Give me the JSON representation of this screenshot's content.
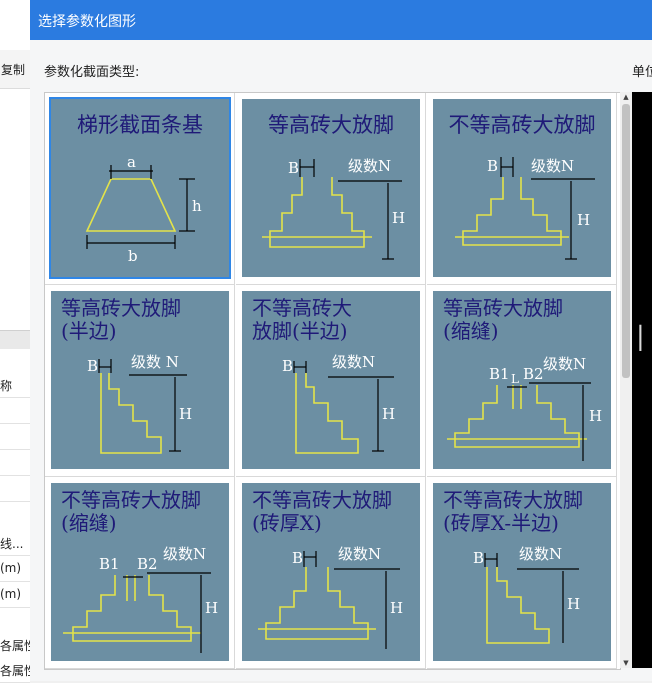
{
  "background": {
    "toolbar_text": "复制",
    "column_header": "称",
    "rows": [
      "线...",
      "(m)",
      "(m)",
      "各属性",
      "各属性"
    ]
  },
  "dialog": {
    "title": "选择参数化图形",
    "section_label": "参数化截面类型:",
    "unit_label": "单位",
    "preview_char": "|"
  },
  "tiles": [
    {
      "title": "梯形截面条基",
      "labels": {
        "a": "a",
        "b": "b",
        "h": "h"
      }
    },
    {
      "title": "等高砖大放脚",
      "labels": {
        "B": "B",
        "N": "级数N",
        "H": "H"
      }
    },
    {
      "title": "不等高砖大放脚",
      "labels": {
        "B": "B",
        "N": "级数N",
        "H": "H"
      }
    },
    {
      "title": "等高砖大放脚\n(半边)",
      "labels": {
        "B": "B",
        "N": "级数 N",
        "H": "H"
      }
    },
    {
      "title": "不等高砖大\n放脚(半边)",
      "labels": {
        "B": "B",
        "N": "级数N",
        "H": "H"
      }
    },
    {
      "title": "等高砖大放脚\n(缩缝)",
      "labels": {
        "B1": "B1",
        "B2": "B2",
        "N": "级数N",
        "L": "L",
        "H": "H"
      }
    },
    {
      "title": "不等高砖大放脚\n(缩缝)",
      "labels": {
        "B1": "B1",
        "B2": "B2",
        "N": "级数N",
        "H": "H"
      }
    },
    {
      "title": "不等高砖大放脚\n(砖厚X)",
      "labels": {
        "B": "B",
        "N": "级数N",
        "H": "H"
      }
    },
    {
      "title": "不等高砖大放脚\n(砖厚X-半边)",
      "labels": {
        "B": "B",
        "N": "级数N",
        "H": "H"
      }
    }
  ],
  "colors": {
    "title_bar": "#2b7be0",
    "tile_bg": "#6c8fa3",
    "selection": "#2f86e6",
    "title_text": "#1f1a78",
    "shape": "#e3e34a"
  }
}
